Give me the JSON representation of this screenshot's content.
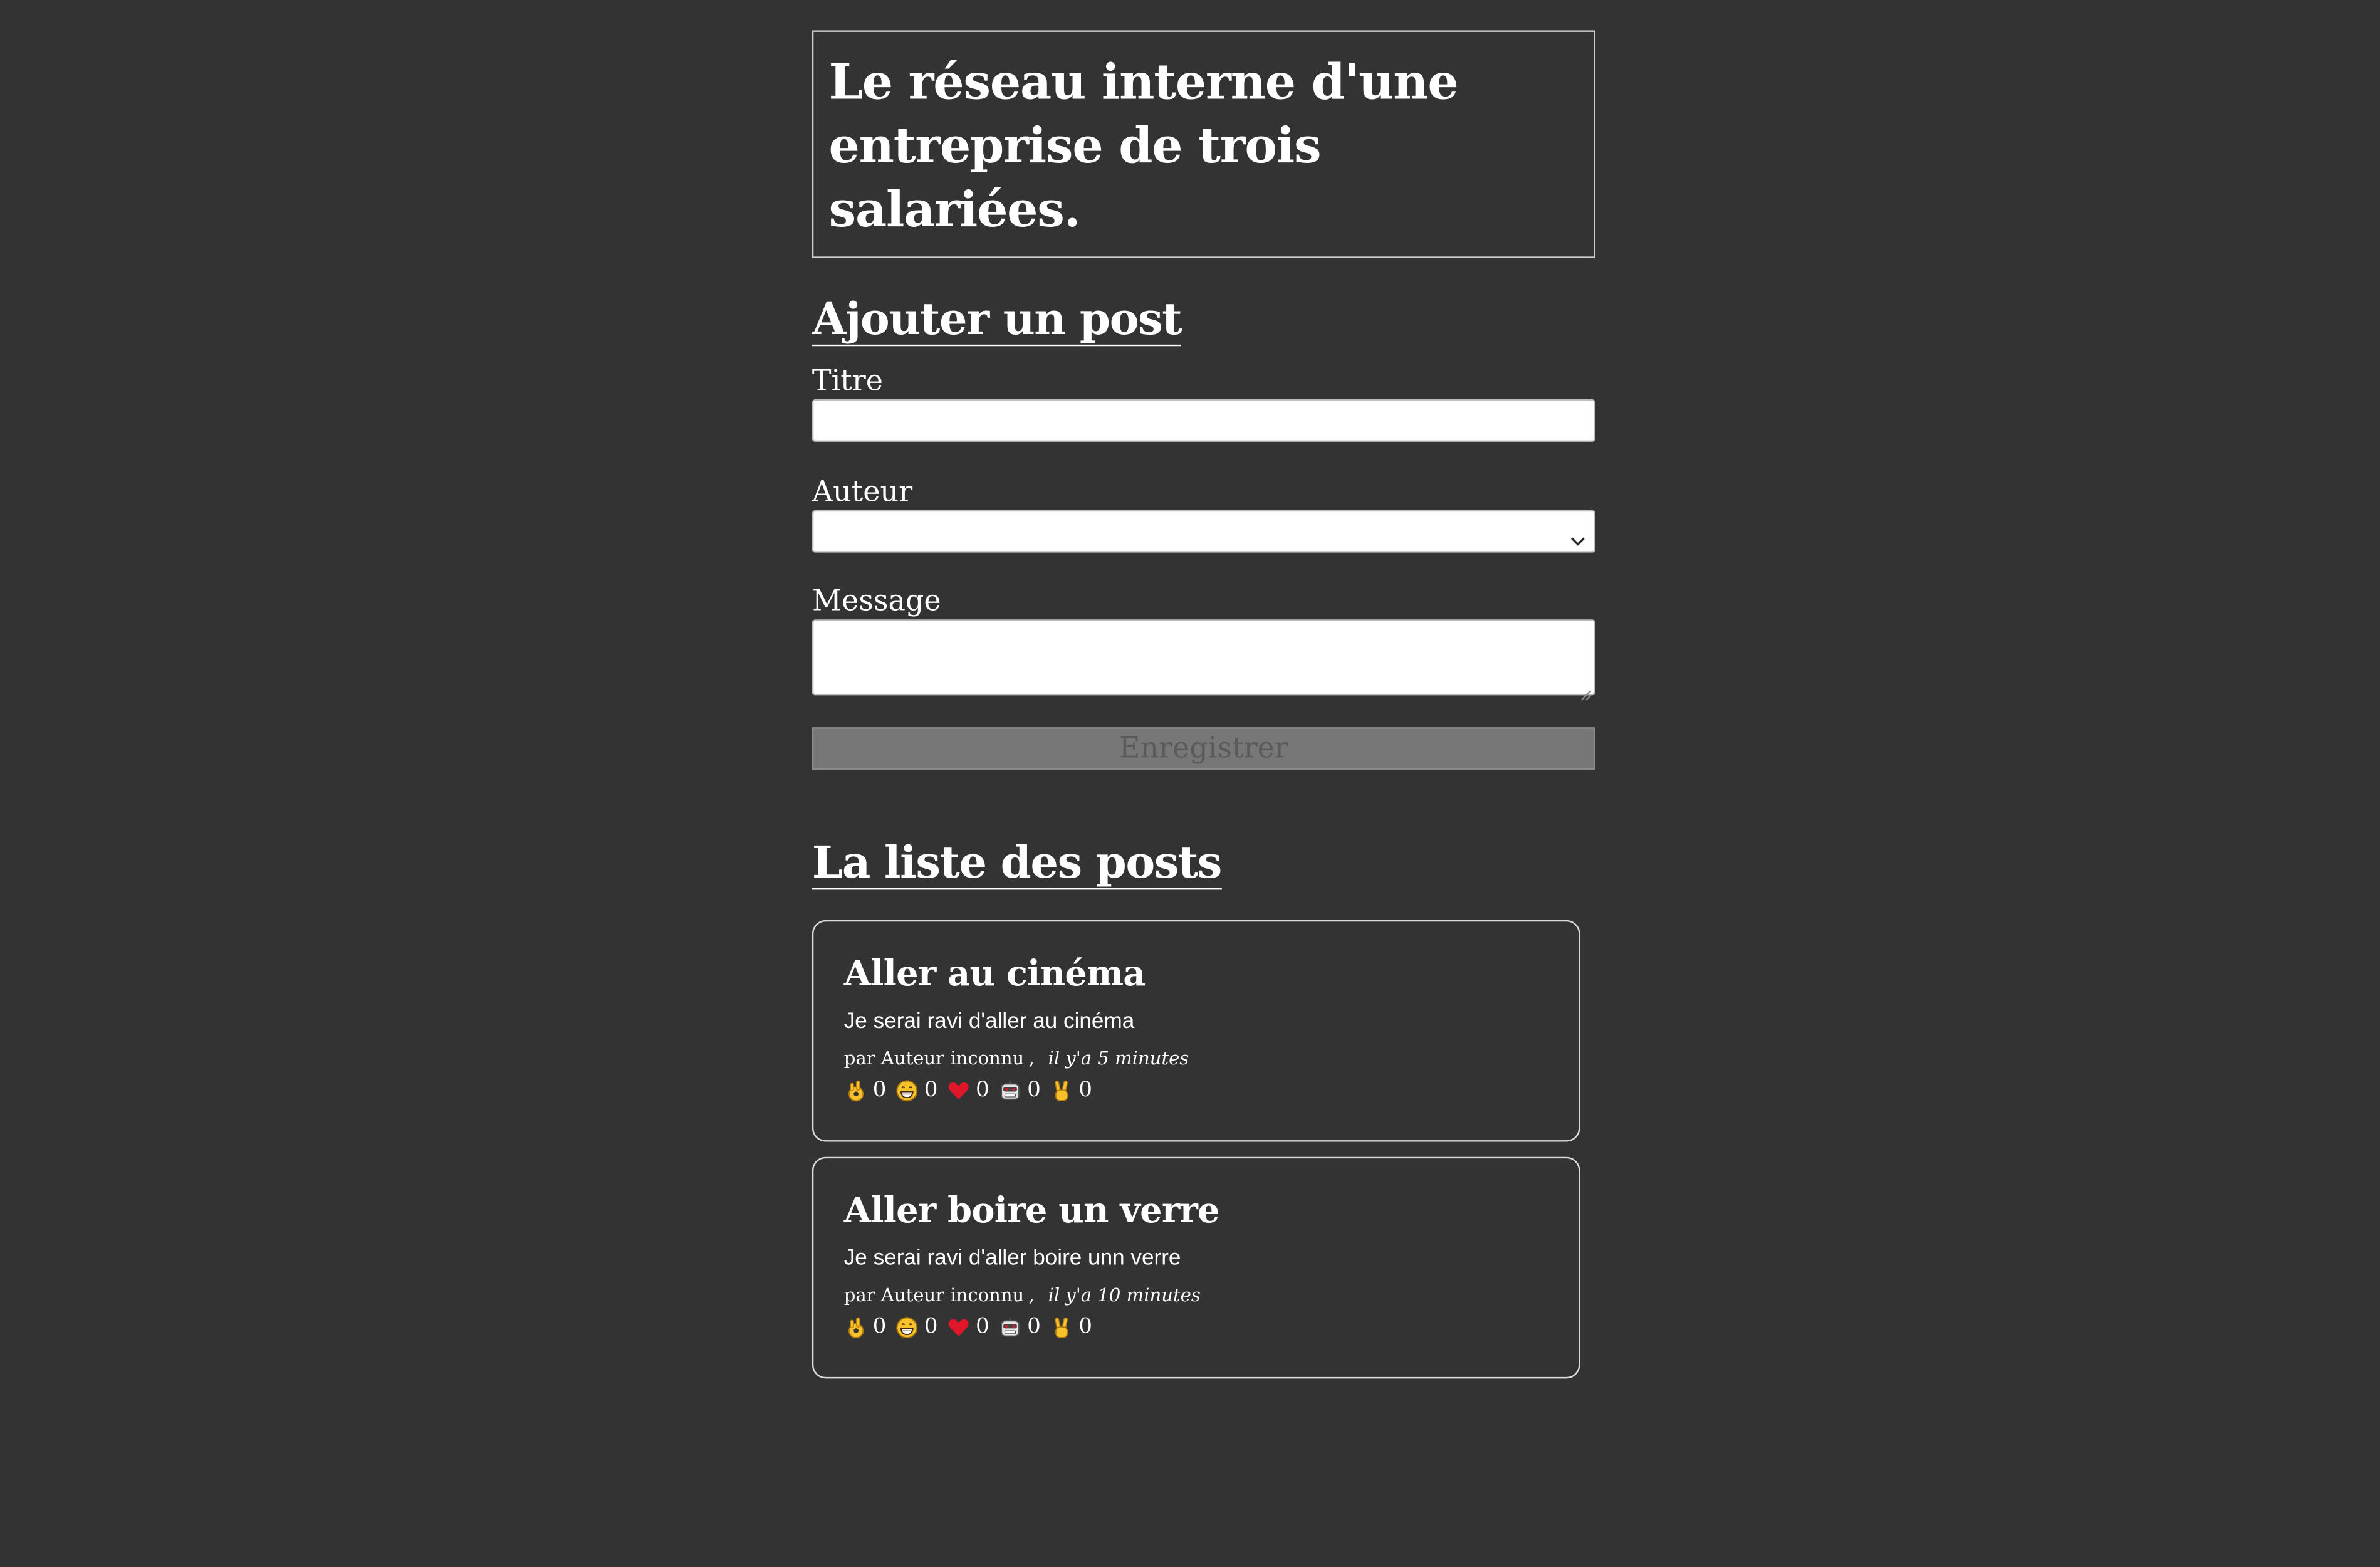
{
  "header": {
    "title": "Le réseau interne d'une entreprise de trois salariées."
  },
  "form": {
    "heading": "Ajouter un post",
    "title_label": "Titre",
    "title_value": "",
    "author_label": "Auteur",
    "author_value": "",
    "message_label": "Message",
    "message_value": "",
    "submit_label": "Enregistrer"
  },
  "list": {
    "heading": "La liste des posts",
    "posts": [
      {
        "title": "Aller au cinéma",
        "body": "Je serai ravi d'aller au cinéma",
        "by_prefix": "par",
        "author": "Auteur inconnu",
        "separator": ",",
        "time": "il y'a 5 minutes",
        "reactions": [
          {
            "icon": "ok-hand-icon",
            "count": "0"
          },
          {
            "icon": "grinning-face-icon",
            "count": "0"
          },
          {
            "icon": "heart-icon",
            "count": "0"
          },
          {
            "icon": "robot-face-icon",
            "count": "0"
          },
          {
            "icon": "victory-hand-icon",
            "count": "0"
          }
        ]
      },
      {
        "title": "Aller boire un verre",
        "body": "Je serai ravi d'aller boire unn verre",
        "by_prefix": "par",
        "author": "Auteur inconnu",
        "separator": ",",
        "time": "il y'a 10 minutes",
        "reactions": [
          {
            "icon": "ok-hand-icon",
            "count": "0"
          },
          {
            "icon": "grinning-face-icon",
            "count": "0"
          },
          {
            "icon": "heart-icon",
            "count": "0"
          },
          {
            "icon": "robot-face-icon",
            "count": "0"
          },
          {
            "icon": "victory-hand-icon",
            "count": "0"
          }
        ]
      }
    ]
  },
  "colors": {
    "background": "#333333",
    "text": "#ffffff",
    "button_bg": "#777777",
    "button_text": "#5a5a5a",
    "emoji_yellow": "#f7c12b",
    "heart_red": "#e0162b"
  }
}
